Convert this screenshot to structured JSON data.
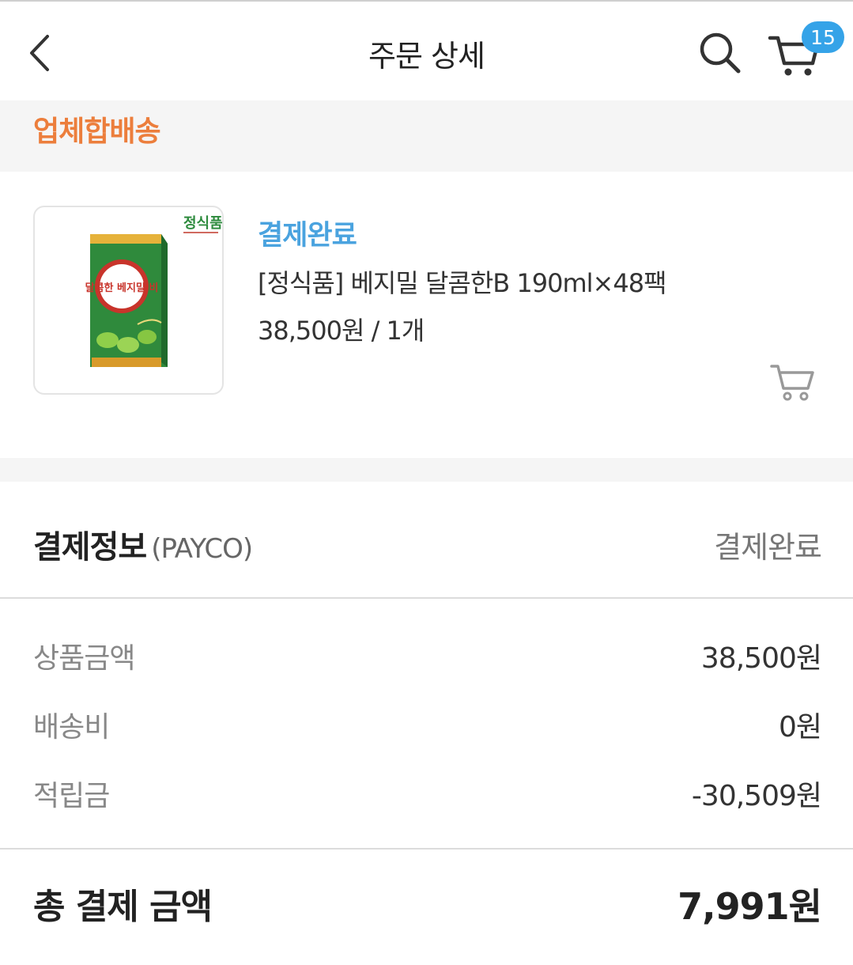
{
  "header": {
    "title": "주문 상세",
    "cart_count": "15"
  },
  "section": {
    "title": "업체합배송"
  },
  "product": {
    "status": "결제완료",
    "name": "[정식품] 베지밀 달콤한B 190ml×48팩",
    "price_qty": "38,500원 / 1개",
    "image_brand": "정식품",
    "image_label": "달콤한 베지밀 비"
  },
  "payment": {
    "title": "결제정보",
    "method": "(PAYCO)",
    "status": "결제완료",
    "rows": [
      {
        "label": "상품금액",
        "value": "38,500원"
      },
      {
        "label": "배송비",
        "value": "0원"
      },
      {
        "label": "적립금",
        "value": "-30,509원"
      }
    ],
    "total_label": "총 결제 금액",
    "total_value": "7,991원"
  },
  "colors": {
    "accent_orange": "#ec7e3c",
    "accent_blue": "#4aa3df",
    "badge_blue": "#35a3e8",
    "band_gray": "#f5f5f5"
  },
  "icons": [
    "back-arrow-icon",
    "search-icon",
    "cart-icon",
    "add-to-cart-icon"
  ]
}
